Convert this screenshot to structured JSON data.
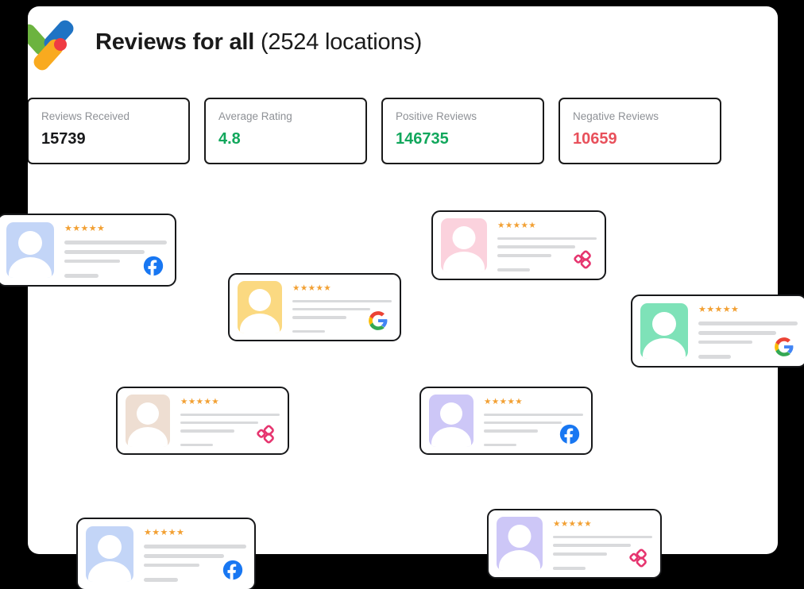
{
  "header": {
    "logo_name": "reviews-app-logo",
    "title_strong": "Reviews for all",
    "title_light": "(2524 locations)"
  },
  "stats": [
    {
      "label": "Reviews Received",
      "value": "15739",
      "tone": "dark"
    },
    {
      "label": "Average Rating",
      "value": "4.8",
      "tone": "green"
    },
    {
      "label": "Positive Reviews",
      "value": "146735",
      "tone": "green"
    },
    {
      "label": "Negative Reviews",
      "value": "10659",
      "tone": "red"
    }
  ],
  "colors": {
    "panel_bg": "#ffffff",
    "page_bg": "#000000",
    "border": "#17181a",
    "muted_label": "#8e9196",
    "value_dark": "#17181a",
    "value_green": "#11a75c",
    "value_red": "#e8505b",
    "star": "#f2a033",
    "skeleton_line": "#d9dadc",
    "facebook": "#1877f2",
    "yelp_pink": "#e6356f"
  },
  "reviews": [
    {
      "id": "review-card-1",
      "stars": "★★★★★",
      "rating": 5,
      "avatar_color": "#c3d5f7",
      "brand": "facebook-icon"
    },
    {
      "id": "review-card-2",
      "stars": "★★★★★",
      "rating": 5,
      "avatar_color": "#fbd2dd",
      "brand": "yelp-icon"
    },
    {
      "id": "review-card-3",
      "stars": "★★★★★",
      "rating": 5,
      "avatar_color": "#fbd981",
      "brand": "google-icon"
    },
    {
      "id": "review-card-4",
      "stars": "★★★★★",
      "rating": 5,
      "avatar_color": "#7ee2b8",
      "brand": "google-icon"
    },
    {
      "id": "review-card-5",
      "stars": "★★★★★",
      "rating": 5,
      "avatar_color": "#eeded2",
      "brand": "yelp-icon"
    },
    {
      "id": "review-card-6",
      "stars": "★★★★★",
      "rating": 5,
      "avatar_color": "#cdc7f7",
      "brand": "facebook-icon"
    },
    {
      "id": "review-card-7",
      "stars": "★★★★★",
      "rating": 5,
      "avatar_color": "#c3d5f7",
      "brand": "facebook-icon"
    },
    {
      "id": "review-card-8",
      "stars": "★★★★★",
      "rating": 5,
      "avatar_color": "#cdc7f7",
      "brand": "yelp-icon"
    }
  ]
}
